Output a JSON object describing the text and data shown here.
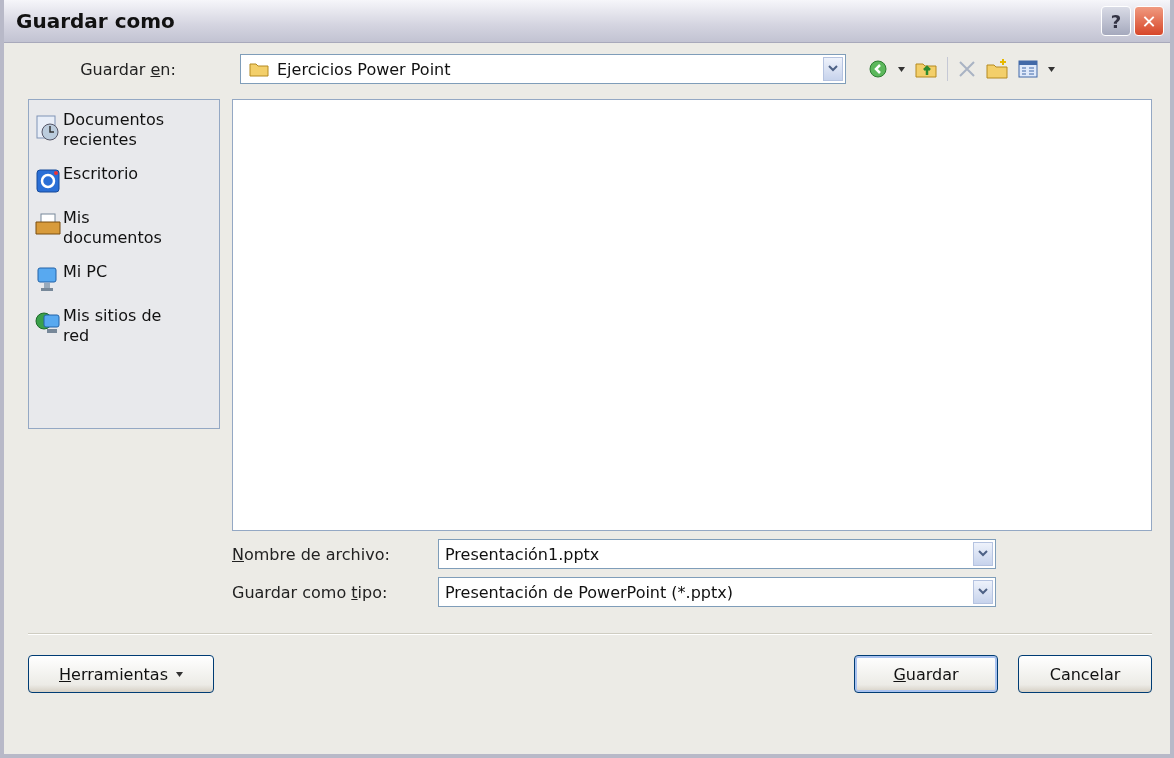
{
  "window": {
    "title": "Guardar como",
    "buttons": [
      {
        "kind": "help",
        "label": "?"
      },
      {
        "kind": "close",
        "label": "✕"
      }
    ]
  },
  "location": {
    "label": {
      "pre": "Guardar ",
      "key": "e",
      "post": "n:"
    },
    "value": "Ejercicios Power Point"
  },
  "toolbar": [
    {
      "kind": "back"
    },
    {
      "kind": "dropdown"
    },
    {
      "kind": "up"
    },
    {
      "kind": "separator"
    },
    {
      "kind": "delete",
      "disabled": true
    },
    {
      "kind": "new-folder"
    },
    {
      "kind": "views"
    },
    {
      "kind": "dropdown"
    }
  ],
  "places": [
    {
      "kind": "recent",
      "label": "Documentos recientes"
    },
    {
      "kind": "desktop",
      "label": "Escritorio"
    },
    {
      "kind": "documents",
      "label": "Mis documentos"
    },
    {
      "kind": "computer",
      "label": "Mi PC"
    },
    {
      "kind": "network",
      "label": "Mis sitios de red"
    }
  ],
  "fields": [
    {
      "label": {
        "key": "N",
        "post": "ombre de archivo:"
      },
      "value": "Presentación1.pptx"
    },
    {
      "label": {
        "pre": "Guardar como ",
        "key": "t",
        "post": "ipo:"
      },
      "value": "Presentación de PowerPoint (*.pptx)"
    }
  ],
  "buttons": [
    {
      "kind": "menu",
      "label": {
        "key": "H",
        "post": "erramientas"
      }
    },
    {
      "kind": "default",
      "label": {
        "key": "G",
        "post": "uardar"
      }
    },
    {
      "kind": "plain",
      "label": {
        "pre": "Cancelar"
      }
    }
  ]
}
